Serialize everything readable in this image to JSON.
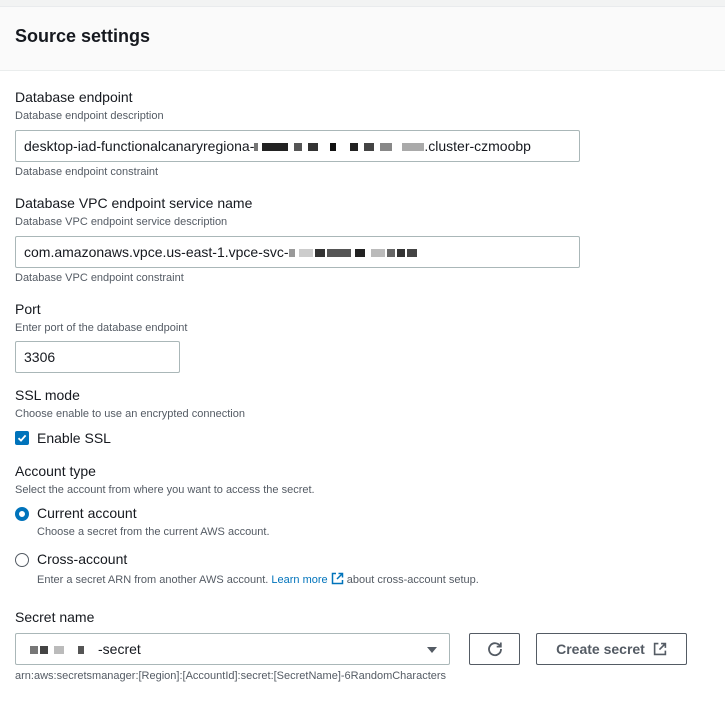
{
  "section": {
    "title": "Source settings"
  },
  "endpoint": {
    "label": "Database endpoint",
    "description": "Database endpoint description",
    "value_prefix": "desktop-iad-functionalcanaryregiona-",
    "value_suffix": ".cluster-czmoobp",
    "constraint": "Database endpoint constraint"
  },
  "vpc": {
    "label": "Database VPC endpoint service name",
    "description": "Database VPC endpoint service description",
    "value_prefix": "com.amazonaws.vpce.us-east-1.vpce-svc-",
    "constraint": "Database VPC endpoint constraint"
  },
  "port": {
    "label": "Port",
    "description": "Enter port of the database endpoint",
    "value": "3306"
  },
  "ssl": {
    "label": "SSL mode",
    "description": "Choose enable to use an encrypted connection",
    "checkbox_label": "Enable SSL",
    "checked": true
  },
  "account": {
    "label": "Account type",
    "description": "Select the account from where you want to access the secret.",
    "options": [
      {
        "label": "Current account",
        "description": "Choose a secret from the current AWS account.",
        "selected": true
      },
      {
        "label": "Cross-account",
        "description_before": "Enter a secret ARN from another AWS account.",
        "link": "Learn more",
        "description_after": "about cross-account setup.",
        "selected": false
      }
    ]
  },
  "secret": {
    "label": "Secret name",
    "value_suffix": "-secret",
    "refresh_icon": "refresh-icon",
    "create_label": "Create secret",
    "hint": "arn:aws:secretsmanager:[Region]:[AccountId]:secret:[SecretName]-6RandomCharacters"
  },
  "colors": {
    "accent": "#0073bb",
    "text": "#16191f",
    "muted": "#545b64",
    "border": "#aab7b8"
  }
}
